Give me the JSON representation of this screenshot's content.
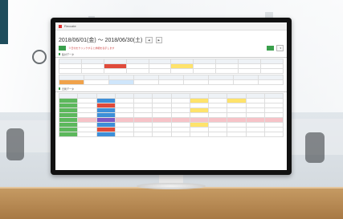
{
  "screen": {
    "window_title": "Reccate",
    "date_range": "2018/06/01(金) 〜 2018/06/30(土)",
    "summary_section": "集計データ",
    "detail_section": "日別データ",
    "note_text": "※日付をクリックすると詳細を表示します"
  },
  "colors": {
    "accent_green": "#3aa04c",
    "monitor_black": "#111111",
    "desk_wood": "#b88550"
  }
}
